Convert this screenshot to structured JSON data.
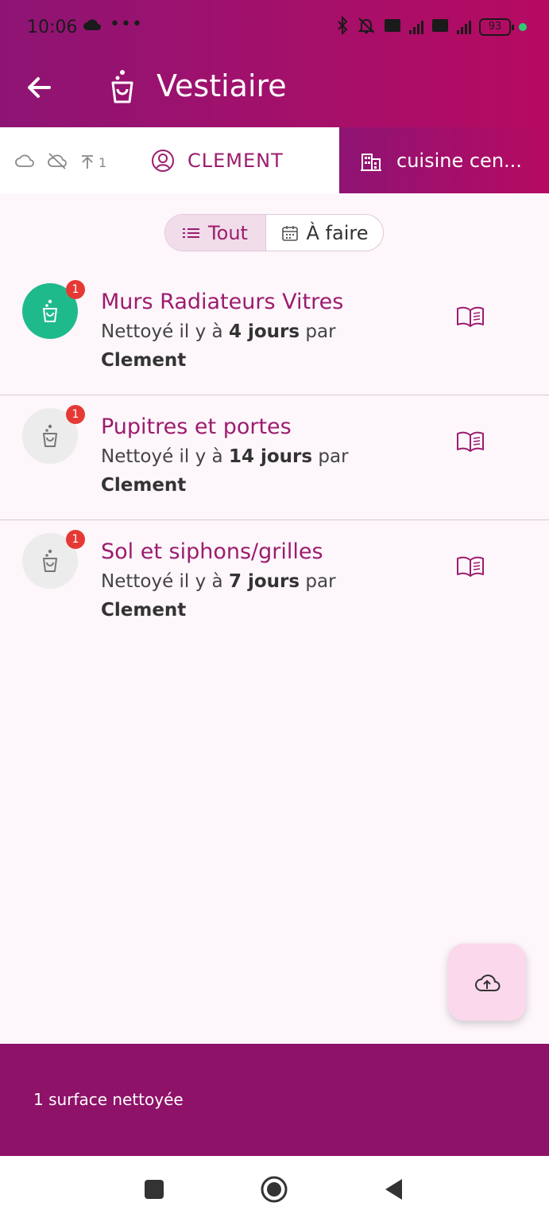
{
  "status_bar": {
    "time": "10:06",
    "dots": "•••",
    "battery": "93"
  },
  "header": {
    "title": "Vestiaire"
  },
  "subbar": {
    "pending_count": "1",
    "user_name": "CLEMENT",
    "site_name": "cuisine cen..."
  },
  "filter": {
    "all_label": "Tout",
    "todo_label": "À faire"
  },
  "items": [
    {
      "title": "Murs Radiateurs Vitres",
      "desc_prefix": "Nettoyé il y à ",
      "desc_bold": "4 jours",
      "desc_suffix": " par",
      "user": "Clement",
      "badge": "1",
      "status": "clean"
    },
    {
      "title": "Pupitres et portes",
      "desc_prefix": "Nettoyé il y à ",
      "desc_bold": "14 jours",
      "desc_suffix": " par",
      "user": "Clement",
      "badge": "1",
      "status": "pending"
    },
    {
      "title": "Sol et siphons/grilles",
      "desc_prefix": "Nettoyé il y à ",
      "desc_bold": "7 jours",
      "desc_suffix": " par",
      "user": "Clement",
      "badge": "1",
      "status": "pending"
    }
  ],
  "footer": {
    "summary": "1 surface nettoyée"
  },
  "colors": {
    "primary": "#9c1c6e",
    "header_start": "#8e1474",
    "header_end": "#b60a62",
    "clean_green": "#1fba8c",
    "badge_red": "#e53935"
  },
  "icons": [
    "back-arrow-icon",
    "cleaning-bucket-icon",
    "cloud-icon",
    "cloud-off-icon",
    "upload-icon",
    "user-circle-icon",
    "building-icon",
    "list-icon",
    "calendar-icon",
    "book-icon",
    "cloud-upload-icon"
  ]
}
